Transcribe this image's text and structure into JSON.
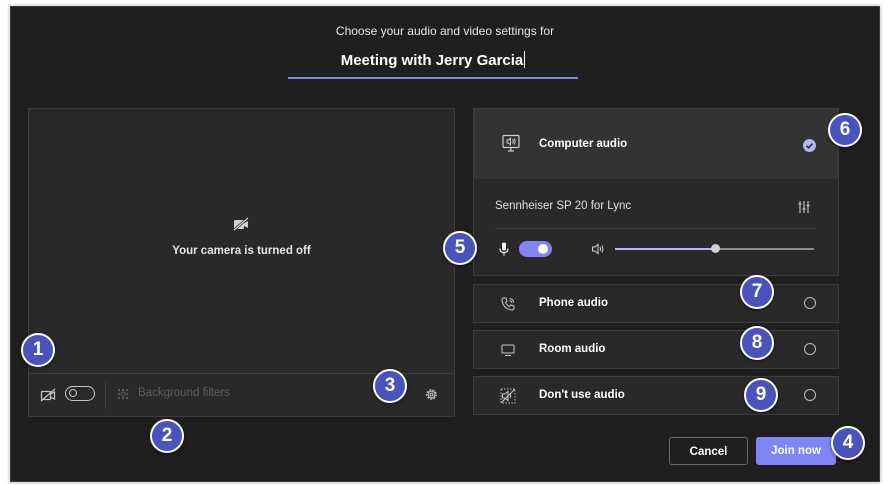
{
  "header": {
    "subtitle": "Choose your audio and video settings for",
    "meeting_title": "Meeting with Jerry Garcia"
  },
  "video_preview": {
    "camera_off_text": "Your camera is turned off",
    "camera_toggle_on": false,
    "background_filters_label": "Background filters"
  },
  "audio": {
    "computer_audio": {
      "label": "Computer audio",
      "selected": true,
      "device_name": "Sennheiser SP 20 for Lync",
      "mic_on": true,
      "volume_fraction": 0.5
    },
    "options": [
      {
        "label": "Phone audio",
        "icon": "phone-audio-icon"
      },
      {
        "label": "Room audio",
        "icon": "room-audio-icon"
      },
      {
        "label": "Don't use audio",
        "icon": "no-audio-icon"
      }
    ]
  },
  "buttons": {
    "cancel": "Cancel",
    "join_now": "Join now"
  },
  "callouts": [
    "1",
    "2",
    "3",
    "4",
    "5",
    "6",
    "7",
    "8",
    "9"
  ],
  "colors": {
    "accent": "#7f85f5",
    "badge": "#4a53bc",
    "background": "#1f1f1f"
  }
}
